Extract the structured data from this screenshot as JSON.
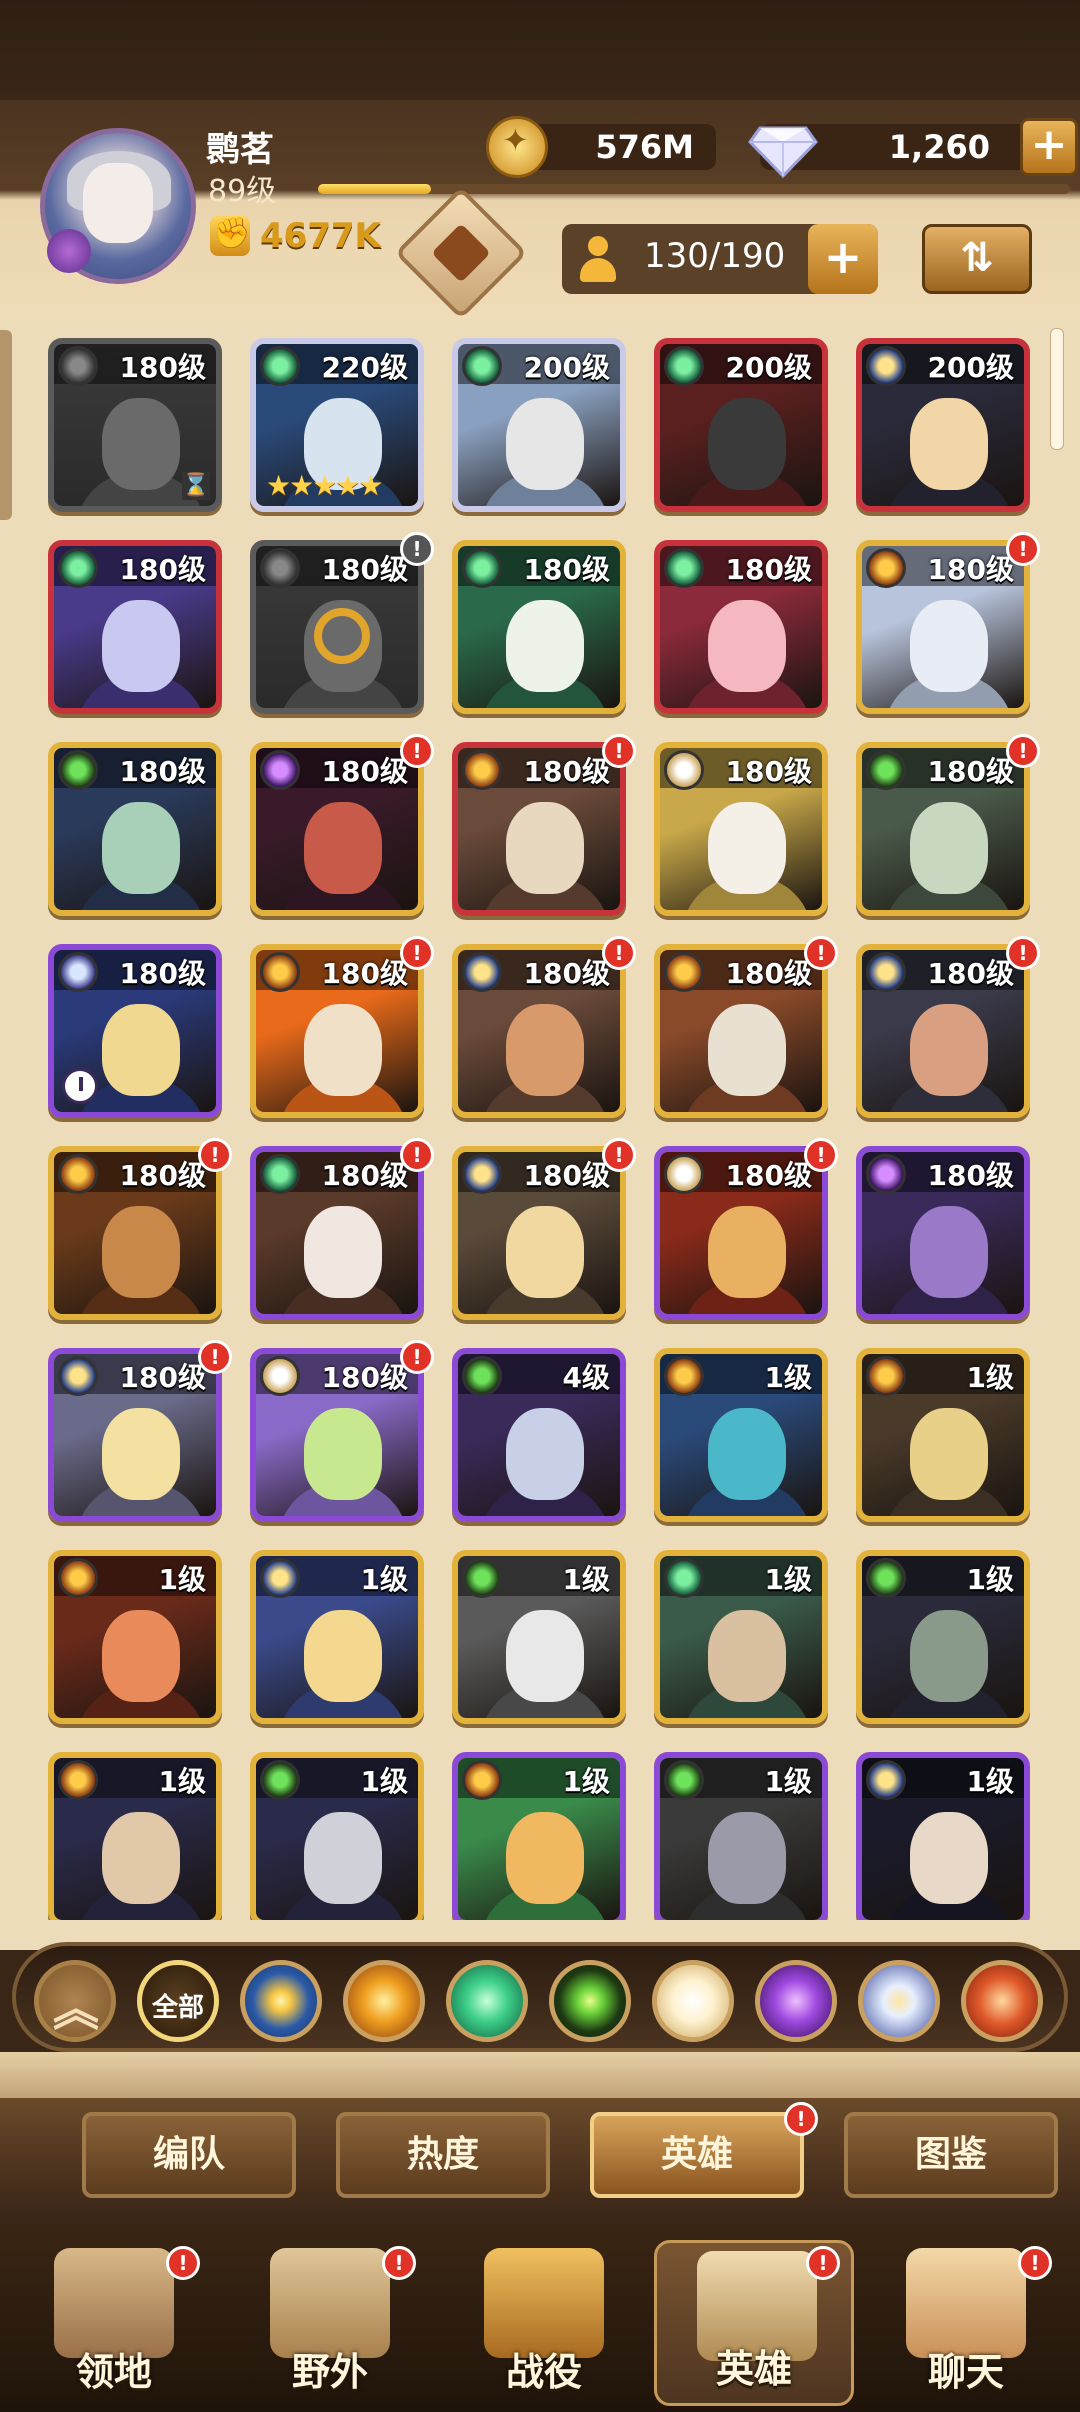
{
  "player": {
    "name": "鹮茗",
    "level": "89级",
    "power": "4677K",
    "xp_fraction": 0.15
  },
  "currency": {
    "gold": "576M",
    "gems": "1,260",
    "add_label": "+"
  },
  "roster": {
    "count": "130/190",
    "add_label": "+"
  },
  "sort_icon": "sort-icon",
  "heroes": [
    {
      "level": "180级",
      "faction": "graveborn",
      "border": "grey",
      "locked": true,
      "hourglass": true,
      "alert": false
    },
    {
      "level": "220级",
      "faction": "wilder",
      "border": "white",
      "stars": "★★★★★",
      "alert": false
    },
    {
      "level": "200级",
      "faction": "wilder",
      "border": "white",
      "alert": false
    },
    {
      "level": "200级",
      "faction": "wilder",
      "border": "red",
      "alert": false
    },
    {
      "level": "200级",
      "faction": "lightbearer",
      "border": "red",
      "alert": false
    },
    {
      "level": "180级",
      "faction": "wilder",
      "border": "red",
      "alert": false
    },
    {
      "level": "180级",
      "faction": "graveborn",
      "border": "grey",
      "chain": true,
      "alert": true,
      "alert_grey": true
    },
    {
      "level": "180级",
      "faction": "wilder",
      "border": "gold",
      "alert": false
    },
    {
      "level": "180级",
      "faction": "wilder",
      "border": "red",
      "alert": false
    },
    {
      "level": "180级",
      "faction": "mauler",
      "border": "gold",
      "alert": true
    },
    {
      "level": "180级",
      "faction": "graveborn",
      "border": "gold",
      "alert": false
    },
    {
      "level": "180级",
      "faction": "hypogean",
      "border": "gold",
      "alert": true
    },
    {
      "level": "180级",
      "faction": "mauler",
      "border": "red",
      "alert": true
    },
    {
      "level": "180级",
      "faction": "celestial",
      "border": "gold",
      "alert": false
    },
    {
      "level": "180级",
      "faction": "graveborn",
      "border": "gold",
      "alert": true
    },
    {
      "level": "180级",
      "faction": "dimensional",
      "border": "purple",
      "clock": true,
      "alert": false
    },
    {
      "level": "180级",
      "faction": "mauler",
      "border": "gold",
      "alert": true
    },
    {
      "level": "180级",
      "faction": "lightbearer",
      "border": "gold",
      "alert": true
    },
    {
      "level": "180级",
      "faction": "mauler",
      "border": "gold",
      "alert": true
    },
    {
      "level": "180级",
      "faction": "lightbearer",
      "border": "gold",
      "alert": true
    },
    {
      "level": "180级",
      "faction": "mauler",
      "border": "gold",
      "alert": true
    },
    {
      "level": "180级",
      "faction": "wilder",
      "border": "purple",
      "alert": true
    },
    {
      "level": "180级",
      "faction": "lightbearer",
      "border": "gold",
      "alert": true
    },
    {
      "level": "180级",
      "faction": "celestial",
      "border": "purple",
      "alert": true
    },
    {
      "level": "180级",
      "faction": "hypogean",
      "border": "purple",
      "alert": false
    },
    {
      "level": "180级",
      "faction": "lightbearer",
      "border": "purple",
      "alert": true
    },
    {
      "level": "180级",
      "faction": "celestial",
      "border": "purple",
      "alert": true
    },
    {
      "level": "4级",
      "faction": "graveborn",
      "border": "purple",
      "alert": false
    },
    {
      "level": "1级",
      "faction": "mauler",
      "border": "gold",
      "alert": false
    },
    {
      "level": "1级",
      "faction": "mauler",
      "border": "gold",
      "alert": false
    },
    {
      "level": "1级",
      "faction": "mauler",
      "border": "gold",
      "alert": false
    },
    {
      "level": "1级",
      "faction": "lightbearer",
      "border": "gold",
      "alert": false
    },
    {
      "level": "1级",
      "faction": "graveborn",
      "border": "gold",
      "alert": false
    },
    {
      "level": "1级",
      "faction": "wilder",
      "border": "gold",
      "alert": false
    },
    {
      "level": "1级",
      "faction": "graveborn",
      "border": "gold",
      "alert": false
    },
    {
      "level": "1级",
      "faction": "mauler",
      "border": "gold",
      "alert": false
    },
    {
      "level": "1级",
      "faction": "graveborn",
      "border": "gold",
      "alert": false
    },
    {
      "level": "1级",
      "faction": "mauler",
      "border": "purple",
      "alert": false
    },
    {
      "level": "1级",
      "faction": "graveborn",
      "border": "purple",
      "alert": false
    },
    {
      "level": "1级",
      "faction": "lightbearer",
      "border": "purple",
      "alert": false
    }
  ],
  "filters": [
    {
      "name": "collapse",
      "icon": "double-chevron-up-icon"
    },
    {
      "name": "all",
      "label": "全部"
    },
    {
      "name": "lightbearer",
      "icon": "lightbearer-star-icon"
    },
    {
      "name": "mauler",
      "icon": "mauler-icon"
    },
    {
      "name": "wilder",
      "icon": "wilder-leaf-icon"
    },
    {
      "name": "graveborn",
      "icon": "graveborn-eye-icon"
    },
    {
      "name": "celestial",
      "icon": "celestial-star-icon"
    },
    {
      "name": "hypogean",
      "icon": "hypogean-crystal-icon"
    },
    {
      "name": "dimensional",
      "icon": "dimensional-orb-icon"
    },
    {
      "name": "flame",
      "icon": "flame-faction-icon"
    }
  ],
  "tabs": [
    {
      "label": "编队",
      "active": false,
      "alert": false
    },
    {
      "label": "热度",
      "active": false,
      "alert": false
    },
    {
      "label": "英雄",
      "active": true,
      "alert": true
    },
    {
      "label": "图鉴",
      "active": false,
      "alert": false
    }
  ],
  "nav": [
    {
      "label": "领地",
      "icon": "castle-icon",
      "alert": true
    },
    {
      "label": "野外",
      "icon": "map-scroll-icon",
      "alert": true
    },
    {
      "label": "战役",
      "icon": "campaign-sword-icon",
      "alert": false
    },
    {
      "label": "英雄",
      "icon": "hero-helmet-icon",
      "alert": true,
      "active": true
    },
    {
      "label": "聊天",
      "icon": "chat-bubble-icon",
      "alert": true
    }
  ],
  "colors": {
    "gold_border": "#e2b23a",
    "purple_border": "#8b4ad6",
    "red_border": "#c8323a",
    "alert": "#e03227"
  }
}
